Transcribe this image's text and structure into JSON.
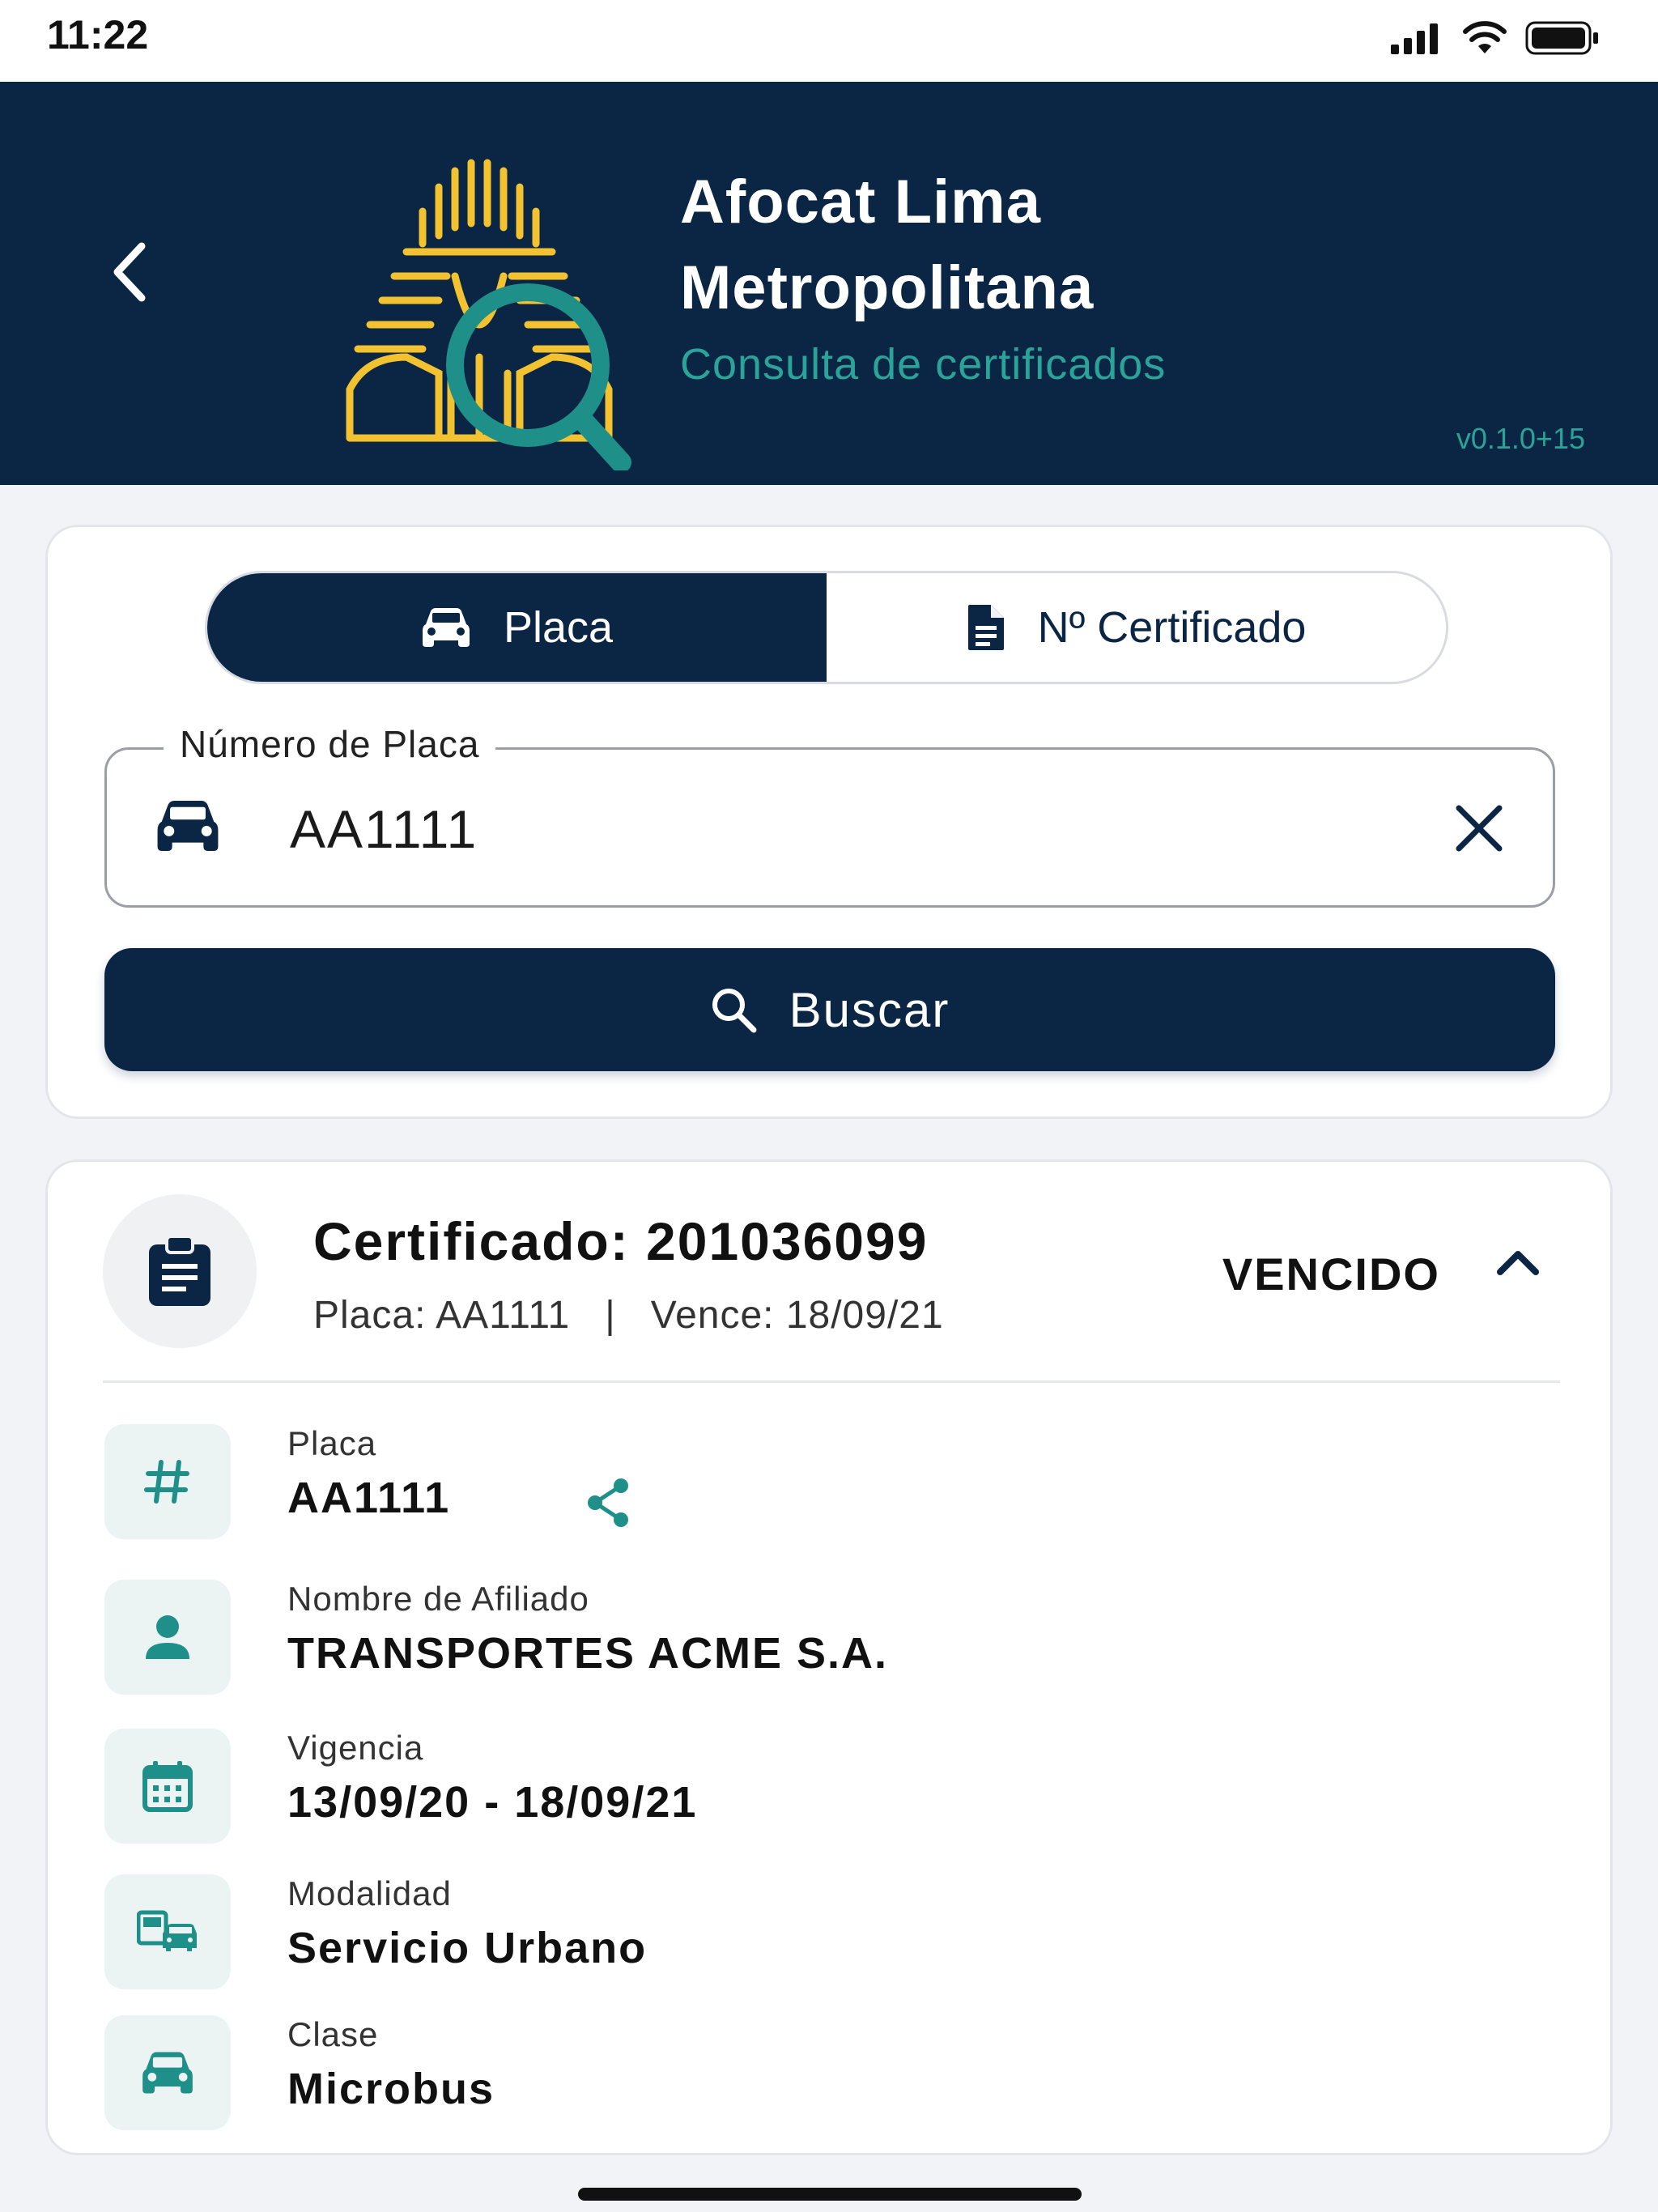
{
  "status_bar": {
    "time": "11:22"
  },
  "header": {
    "title_line1": "Afocat Lima",
    "title_line2": "Metropolitana",
    "subtitle": "Consulta de certificados",
    "version": "v0.1.0+15"
  },
  "colors": {
    "navy": "#0b2545",
    "teal": "#2aa39a",
    "logo_yellow": "#f2c230"
  },
  "tabs": [
    {
      "label": "Placa",
      "icon": "car-icon",
      "active": true
    },
    {
      "label": "Nº Certificado",
      "icon": "document-icon",
      "active": false
    }
  ],
  "search": {
    "field_label": "Número de Placa",
    "value": "AA1111",
    "button_label": "Buscar"
  },
  "result": {
    "title": "Certificado: 201036099",
    "subtitle": "Placa: AA1111   |   Vence: 18/09/21",
    "status": "VENCIDO",
    "details": [
      {
        "label": "Placa",
        "value": "AA1111",
        "icon": "hash-icon"
      },
      {
        "label": "Nombre de Afiliado",
        "value": "TRANSPORTES ACME S.A.",
        "icon": "person-icon"
      },
      {
        "label": "Vigencia",
        "value": "13/09/20 - 18/09/21",
        "icon": "calendar-icon"
      },
      {
        "label": "Modalidad",
        "value": "Servicio Urbano",
        "icon": "transport-icon"
      },
      {
        "label": "Clase",
        "value": "Microbus",
        "icon": "car-icon"
      }
    ]
  }
}
